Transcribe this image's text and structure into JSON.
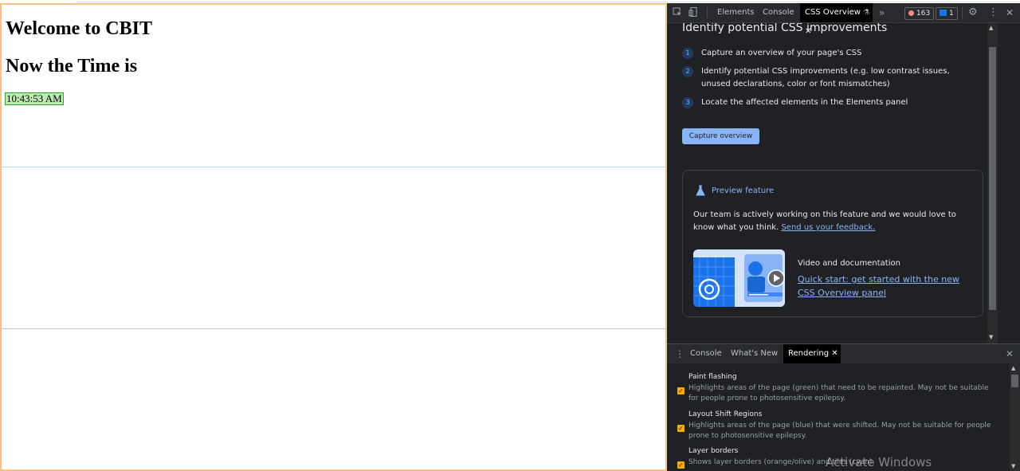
{
  "page": {
    "heading1": "Welcome to CBIT",
    "heading2": "Now the Time is",
    "time": "10:43:53 AM"
  },
  "devtools": {
    "tabs": [
      "Elements",
      "Console",
      "CSS Overview"
    ],
    "more": "»",
    "errors": "163",
    "messages": "1",
    "css_overview": {
      "title": "Identify potential CSS improvements",
      "steps": [
        {
          "num": "1",
          "text": "Capture an overview of your page's CSS"
        },
        {
          "num": "2",
          "text": "Identify potential CSS improvements (e.g. low contrast issues, unused declarations, color or font mismatches)"
        },
        {
          "num": "3",
          "text": "Locate the affected elements in the Elements panel"
        }
      ],
      "capture_button": "Capture overview",
      "preview": {
        "heading": "Preview feature",
        "text": "Our team is actively working on this feature and we would love to know what you think.",
        "link": "Send us your feedback.",
        "video_title": "Video and documentation",
        "video_link": "Quick start: get started with the new CSS Overview panel"
      }
    },
    "drawer": {
      "tabs": [
        "Console",
        "What's New",
        "Rendering"
      ],
      "options": [
        {
          "title": "Paint flashing",
          "desc": "Highlights areas of the page (green) that need to be repainted. May not be suitable for people prone to photosensitive epilepsy.",
          "checked": true
        },
        {
          "title": "Layout Shift Regions",
          "desc": "Highlights areas of the page (blue) that were shifted. May not be suitable for people prone to photosensitive epilepsy.",
          "checked": true
        },
        {
          "title": "Layer borders",
          "desc": "Shows layer borders (orange/olive) and tiles (cyan).",
          "checked": true
        }
      ]
    },
    "watermark": "Activate Windows"
  },
  "colors": {
    "accent": "#8ab4f8",
    "checkbox": "#f9ab00",
    "paint_flash": "#bdeab0",
    "layer_border": "#f9c08a"
  }
}
